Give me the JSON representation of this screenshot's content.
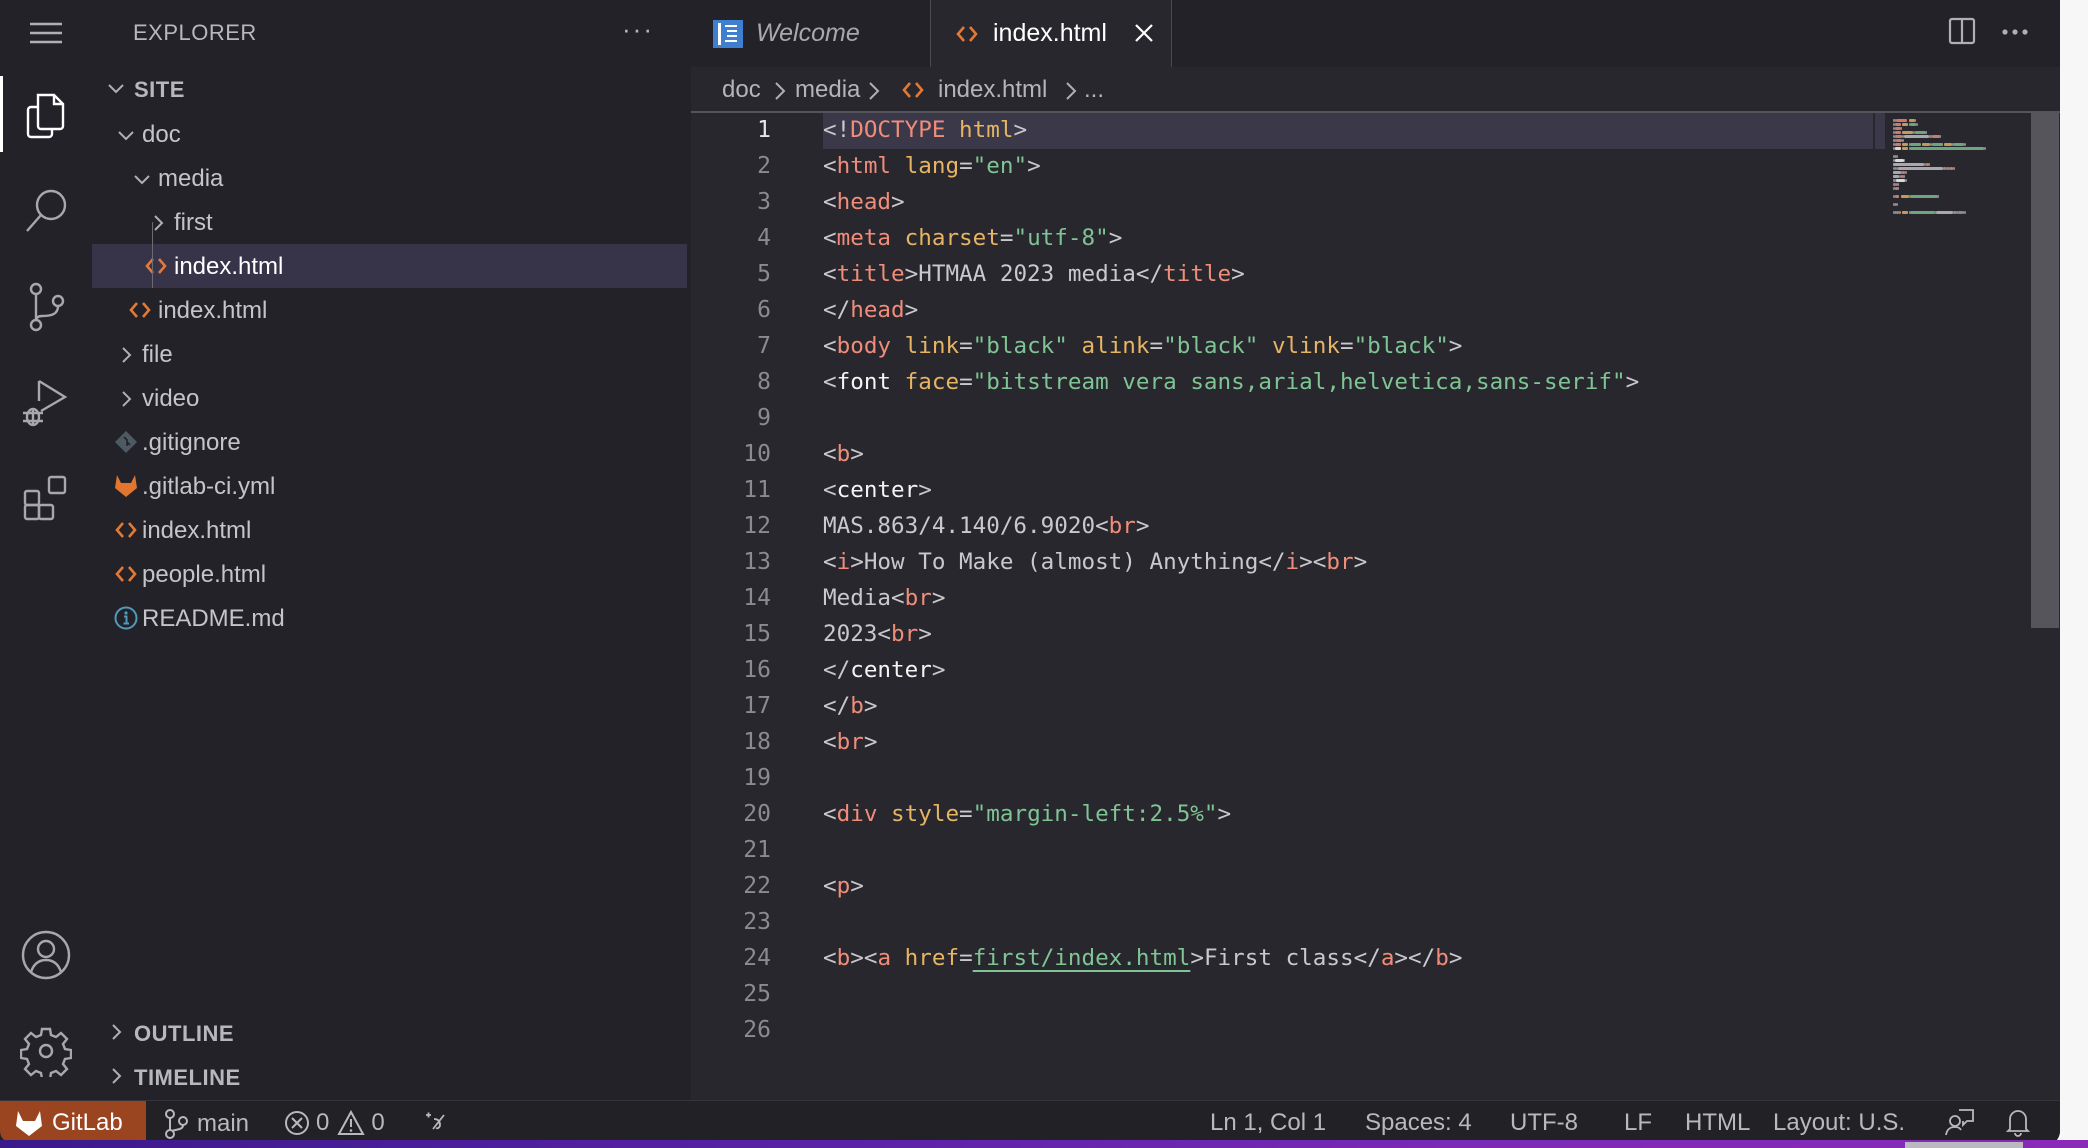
{
  "activity_bar": {
    "items": [
      {
        "name": "explorer",
        "icon": "files-icon",
        "active": true
      },
      {
        "name": "search",
        "icon": "search-icon",
        "active": false
      },
      {
        "name": "source-control",
        "icon": "source-control-icon",
        "active": false
      },
      {
        "name": "run-and-debug",
        "icon": "run-debug-icon",
        "active": false
      },
      {
        "name": "extensions",
        "icon": "extensions-icon",
        "active": false
      }
    ],
    "bottom": [
      {
        "name": "accounts",
        "icon": "account-icon"
      },
      {
        "name": "manage",
        "icon": "gear-icon"
      }
    ]
  },
  "sidebar": {
    "title": "EXPLORER",
    "more_label": "···",
    "root_label": "SITE",
    "tree": [
      {
        "label": "doc",
        "type": "folder",
        "expanded": true,
        "depth": 1
      },
      {
        "label": "media",
        "type": "folder",
        "expanded": true,
        "depth": 2
      },
      {
        "label": "first",
        "type": "folder",
        "expanded": false,
        "depth": 3
      },
      {
        "label": "index.html",
        "type": "html",
        "depth": 3,
        "selected": true
      },
      {
        "label": "index.html",
        "type": "html",
        "depth": 2
      },
      {
        "label": "file",
        "type": "folder",
        "expanded": false,
        "depth": 1
      },
      {
        "label": "video",
        "type": "folder",
        "expanded": false,
        "depth": 1
      },
      {
        "label": ".gitignore",
        "type": "git",
        "depth": 1
      },
      {
        "label": ".gitlab-ci.yml",
        "type": "gitlab",
        "depth": 1
      },
      {
        "label": "index.html",
        "type": "html",
        "depth": 1
      },
      {
        "label": "people.html",
        "type": "html",
        "depth": 1
      },
      {
        "label": "README.md",
        "type": "info",
        "depth": 1
      }
    ],
    "outline_label": "OUTLINE",
    "timeline_label": "TIMELINE"
  },
  "tabs": [
    {
      "label": "Welcome",
      "icon": "welcome-icon",
      "active": false,
      "preview": true
    },
    {
      "label": "index.html",
      "icon": "html-file-icon",
      "active": true
    }
  ],
  "breadcrumb": [
    "doc",
    "media",
    "index.html",
    "..."
  ],
  "editor": {
    "current_line": 1,
    "lines": [
      [
        [
          "punc",
          "<!"
        ],
        [
          "doctype",
          "DOCTYPE"
        ],
        [
          "punc",
          " "
        ],
        [
          "doctype-kw",
          "html"
        ],
        [
          "punc",
          ">"
        ]
      ],
      [
        [
          "punc",
          "<"
        ],
        [
          "tag",
          "html"
        ],
        [
          "punc",
          " "
        ],
        [
          "attr",
          "lang"
        ],
        [
          "punc",
          "="
        ],
        [
          "str",
          "\"en\""
        ],
        [
          "punc",
          ">"
        ]
      ],
      [
        [
          "punc",
          "<"
        ],
        [
          "tag",
          "head"
        ],
        [
          "punc",
          ">"
        ]
      ],
      [
        [
          "punc",
          "<"
        ],
        [
          "tag",
          "meta"
        ],
        [
          "punc",
          " "
        ],
        [
          "attr",
          "charset"
        ],
        [
          "punc",
          "="
        ],
        [
          "str",
          "\"utf-8\""
        ],
        [
          "punc",
          ">"
        ]
      ],
      [
        [
          "punc",
          "<"
        ],
        [
          "tag",
          "title"
        ],
        [
          "punc",
          ">"
        ],
        [
          "text",
          "HTMAA 2023 media"
        ],
        [
          "punc",
          "</"
        ],
        [
          "tag",
          "title"
        ],
        [
          "punc",
          ">"
        ]
      ],
      [
        [
          "punc",
          "</"
        ],
        [
          "tag",
          "head"
        ],
        [
          "punc",
          ">"
        ]
      ],
      [
        [
          "punc",
          "<"
        ],
        [
          "tag",
          "body"
        ],
        [
          "punc",
          " "
        ],
        [
          "attr",
          "link"
        ],
        [
          "punc",
          "="
        ],
        [
          "str",
          "\"black\""
        ],
        [
          "punc",
          " "
        ],
        [
          "attr",
          "alink"
        ],
        [
          "punc",
          "="
        ],
        [
          "str",
          "\"black\""
        ],
        [
          "punc",
          " "
        ],
        [
          "attr",
          "vlink"
        ],
        [
          "punc",
          "="
        ],
        [
          "str",
          "\"black\""
        ],
        [
          "punc",
          ">"
        ]
      ],
      [
        [
          "punc",
          "<"
        ],
        [
          "dep",
          "font"
        ],
        [
          "punc",
          " "
        ],
        [
          "attr",
          "face"
        ],
        [
          "punc",
          "="
        ],
        [
          "str",
          "\"bitstream vera sans,arial,helvetica,sans-serif\""
        ],
        [
          "punc",
          ">"
        ]
      ],
      [],
      [
        [
          "punc",
          "<"
        ],
        [
          "tag",
          "b"
        ],
        [
          "punc",
          ">"
        ]
      ],
      [
        [
          "punc",
          "<"
        ],
        [
          "dep",
          "center"
        ],
        [
          "punc",
          ">"
        ]
      ],
      [
        [
          "text",
          "MAS.863/4.140/6.9020"
        ],
        [
          "punc",
          "<"
        ],
        [
          "tag",
          "br"
        ],
        [
          "punc",
          ">"
        ]
      ],
      [
        [
          "punc",
          "<"
        ],
        [
          "tag",
          "i"
        ],
        [
          "punc",
          ">"
        ],
        [
          "text",
          "How To Make (almost) Anything"
        ],
        [
          "punc",
          "</"
        ],
        [
          "tag",
          "i"
        ],
        [
          "punc",
          "><"
        ],
        [
          "tag",
          "br"
        ],
        [
          "punc",
          ">"
        ]
      ],
      [
        [
          "text",
          "Media"
        ],
        [
          "punc",
          "<"
        ],
        [
          "tag",
          "br"
        ],
        [
          "punc",
          ">"
        ]
      ],
      [
        [
          "text",
          "2023"
        ],
        [
          "punc",
          "<"
        ],
        [
          "tag",
          "br"
        ],
        [
          "punc",
          ">"
        ]
      ],
      [
        [
          "punc",
          "</"
        ],
        [
          "dep",
          "center"
        ],
        [
          "punc",
          ">"
        ]
      ],
      [
        [
          "punc",
          "</"
        ],
        [
          "tag",
          "b"
        ],
        [
          "punc",
          ">"
        ]
      ],
      [
        [
          "punc",
          "<"
        ],
        [
          "tag",
          "br"
        ],
        [
          "punc",
          ">"
        ]
      ],
      [],
      [
        [
          "punc",
          "<"
        ],
        [
          "tag",
          "div"
        ],
        [
          "punc",
          " "
        ],
        [
          "attr",
          "style"
        ],
        [
          "punc",
          "="
        ],
        [
          "str",
          "\"margin-left:2.5%\""
        ],
        [
          "punc",
          ">"
        ]
      ],
      [],
      [
        [
          "punc",
          "<"
        ],
        [
          "tag",
          "p"
        ],
        [
          "punc",
          ">"
        ]
      ],
      [],
      [
        [
          "punc",
          "<"
        ],
        [
          "tag",
          "b"
        ],
        [
          "punc",
          "><"
        ],
        [
          "tag",
          "a"
        ],
        [
          "punc",
          " "
        ],
        [
          "attr",
          "href"
        ],
        [
          "punc",
          "="
        ],
        [
          "link",
          "first/index.html"
        ],
        [
          "punc",
          ">"
        ],
        [
          "text",
          "First class"
        ],
        [
          "punc",
          "</"
        ],
        [
          "tag",
          "a"
        ],
        [
          "punc",
          "></"
        ],
        [
          "tag",
          "b"
        ],
        [
          "punc",
          ">"
        ]
      ],
      [],
      []
    ]
  },
  "statusbar": {
    "remote_label": "GitLab",
    "branch": "main",
    "errors": "0",
    "warnings": "0",
    "cursor_position": "Ln 1, Col 1",
    "indentation": "Spaces: 4",
    "encoding": "UTF-8",
    "eol": "LF",
    "language": "HTML",
    "keyboard_layout": "Layout: U.S."
  },
  "colors": {
    "accent_remote": "#9a4420",
    "html_icon": "#e37933",
    "gitlab_icon": "#e2762f",
    "info_icon": "#519aba",
    "welcome_icon": "#3f7fcf"
  }
}
